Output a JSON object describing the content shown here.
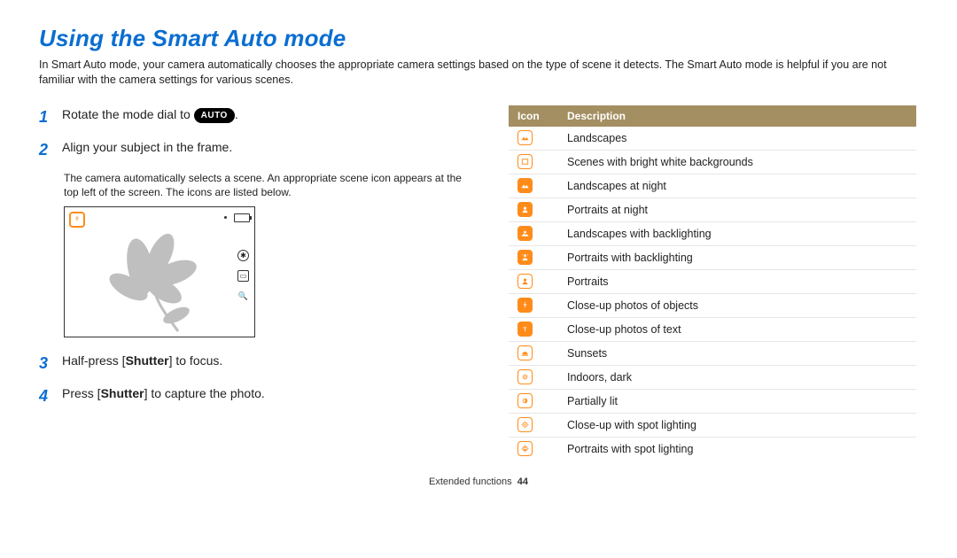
{
  "title": "Using the Smart Auto mode",
  "intro": "In Smart Auto mode, your camera automatically chooses the appropriate camera settings based on the type of scene it detects. The Smart Auto mode is helpful if you are not familiar with the camera settings for various scenes.",
  "steps": {
    "s1_pre": "Rotate the mode dial to ",
    "s1_pill": "AUTO",
    "s1_post": ".",
    "s2": "Align your subject in the frame.",
    "s2_sub": "The camera automatically selects a scene. An appropriate scene icon appears at the top left of the screen. The icons are listed below.",
    "s3_pre": "Half-press [",
    "s3_b": "Shutter",
    "s3_post": "] to focus.",
    "s4_pre": "Press [",
    "s4_b": "Shutter",
    "s4_post": "] to capture the photo."
  },
  "nums": {
    "n1": "1",
    "n2": "2",
    "n3": "3",
    "n4": "4"
  },
  "table": {
    "h_icon": "Icon",
    "h_desc": "Description",
    "rows": [
      "Landscapes",
      "Scenes with bright white backgrounds",
      "Landscapes at night",
      "Portraits at night",
      "Landscapes with backlighting",
      "Portraits with backlighting",
      "Portraits",
      "Close-up photos of objects",
      "Close-up photos of text",
      "Sunsets",
      "Indoors, dark",
      "Partially lit",
      "Close-up with spot lighting",
      "Portraits with spot lighting"
    ]
  },
  "footer": {
    "section": "Extended functions",
    "page": "44"
  }
}
